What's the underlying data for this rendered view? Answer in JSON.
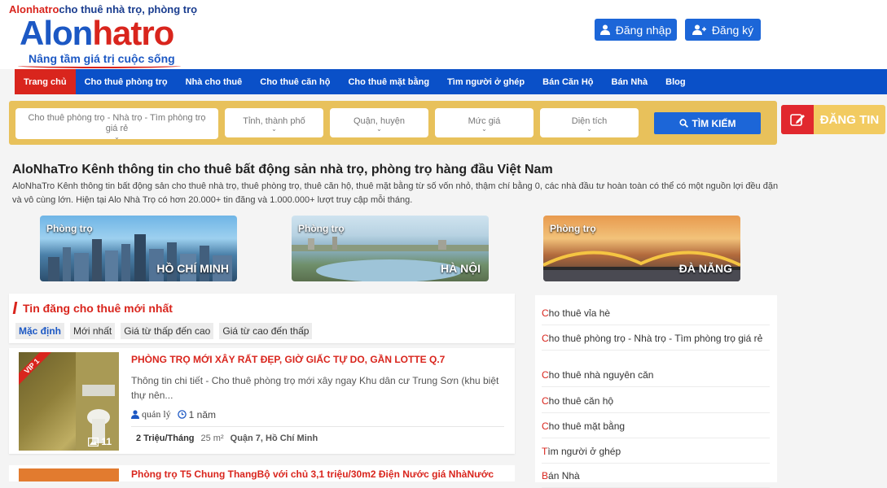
{
  "header": {
    "tagline_brand": "Alonhatro",
    "tagline_rest": "cho thuê nhà trọ, phòng trọ",
    "logo_part1": "Alon",
    "logo_part2": "hatro",
    "slogan": "Nâng tầm giá trị cuộc sống",
    "login_label": "Đăng nhập",
    "register_label": "Đăng ký"
  },
  "nav": {
    "items": [
      {
        "label": "Trang chủ"
      },
      {
        "label": "Cho thuê phòng trọ"
      },
      {
        "label": "Nhà cho thuê"
      },
      {
        "label": "Cho thuê căn hộ"
      },
      {
        "label": "Cho thuê mặt bằng"
      },
      {
        "label": "Tìm người ở ghép"
      },
      {
        "label": "Bán Căn Hộ"
      },
      {
        "label": "Bán Nhà"
      },
      {
        "label": "Blog"
      }
    ]
  },
  "search": {
    "category": "Cho thuê phòng trọ - Nhà trọ - Tìm phòng trọ giá rẻ",
    "province": "Tỉnh, thành phố",
    "district": "Quận, huyện",
    "price": "Mức giá",
    "area": "Diện tích",
    "button": "TÌM KIẾM"
  },
  "post_button": "ĐĂNG TIN",
  "intro": {
    "title": "AloNhaTro Kênh thông tin cho thuê bất động sản nhà trọ, phòng trọ hàng đầu Việt Nam",
    "text": "AloNhaTro Kênh thông tin bất động sản cho thuê nhà trọ, thuê phòng trọ, thuê căn hộ, thuê mặt bằng từ số vốn nhỏ, thậm chí bằng 0, các nhà đầu tư hoàn toàn có thể có một nguồn lợi đều đặn và vô cùng lớn. Hiện tại Alo Nhà Trọ có hơn 20.000+ tin đăng và 1.000.000+ lượt truy cập mỗi tháng."
  },
  "cities": [
    {
      "tag": "Phòng trọ",
      "name": "HỒ CHÍ MINH"
    },
    {
      "tag": "Phòng trọ",
      "name": "HÀ NỘI"
    },
    {
      "tag": "Phòng trọ",
      "name": "ĐÀ NẴNG"
    }
  ],
  "listings_panel": {
    "title": "Tin đăng cho thuê mới nhất",
    "sorts": [
      "Mặc định",
      "Mới nhất",
      "Giá từ thấp đến cao",
      "Giá từ cao đến thấp"
    ]
  },
  "listing1": {
    "badge": "VIP 1",
    "image_count": "11",
    "title": "PHÒNG TRỌ MỚI XÂY RẤT ĐẸP, GIỜ GIẤC TỰ DO, GẦN LOTTE Q.7",
    "desc": "Thông tin chi tiết - Cho thuê phòng trọ mới xây ngay Khu dân cư Trung Sơn (khu biệt thự nên...",
    "author": "quản lý",
    "time": "1 năm",
    "price": "2 Triệu/Tháng",
    "area": "25 m²",
    "location": "Quận 7, Hồ Chí Minh"
  },
  "listing2": {
    "title": "Phòng trọ T5 Chung ThangBộ với chủ 3,1 triệu/30m2 Điện Nước giá NhàNước"
  },
  "sidebar": {
    "categories": [
      {
        "first": "C",
        "rest": "ho thuê vỉa hè"
      },
      {
        "first": "C",
        "rest": "ho thuê phòng trọ - Nhà trọ - Tìm phòng trọ giá rẻ"
      },
      {
        "first": "C",
        "rest": "ho thuê nhà nguyên căn"
      },
      {
        "first": "C",
        "rest": "ho thuê căn hộ"
      },
      {
        "first": "C",
        "rest": "ho thuê mặt bằng"
      },
      {
        "first": "T",
        "rest": "ìm người ở ghép"
      },
      {
        "first": "B",
        "rest": "án Nhà"
      }
    ]
  },
  "colors": {
    "brand_red": "#d9251d",
    "brand_blue": "#1c58c4",
    "nav_blue": "#0a50c8",
    "search_yellow": "#e8c15b"
  }
}
